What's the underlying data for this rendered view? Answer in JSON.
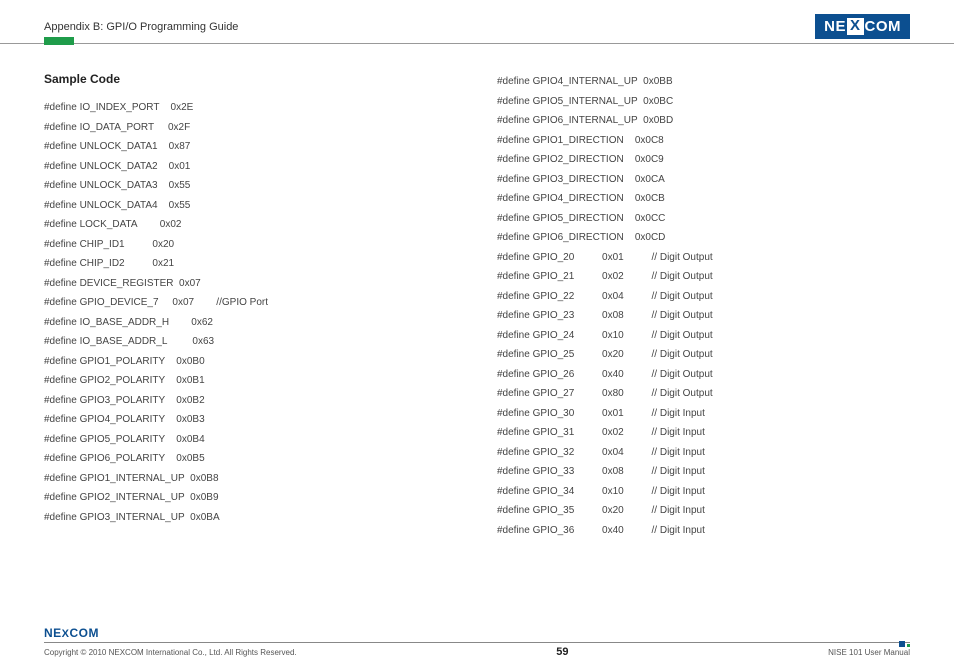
{
  "header": {
    "title": "Appendix B: GPI/O Programming Guide",
    "logo_left": "NE",
    "logo_mid": "X",
    "logo_right": "COM"
  },
  "section_heading": "Sample Code",
  "left_lines": [
    {
      "text": "#define IO_INDEX_PORT    0x2E"
    },
    {
      "text": "#define IO_DATA_PORT     0x2F"
    },
    {
      "text": "#define UNLOCK_DATA1    0x87"
    },
    {
      "text": "#define UNLOCK_DATA2    0x01"
    },
    {
      "text": "#define UNLOCK_DATA3    0x55"
    },
    {
      "text": "#define UNLOCK_DATA4    0x55"
    },
    {
      "text": "#define LOCK_DATA        0x02"
    },
    {
      "text": "#define CHIP_ID1          0x20"
    },
    {
      "text": "#define CHIP_ID2          0x21"
    },
    {
      "text": "#define DEVICE_REGISTER  0x07"
    },
    {
      "text": "#define GPIO_DEVICE_7     0x07        //GPIO Port"
    },
    {
      "text": "#define IO_BASE_ADDR_H        0x62"
    },
    {
      "text": "#define IO_BASE_ADDR_L         0x63"
    },
    {
      "text": "#define GPIO1_POLARITY    0x0B0"
    },
    {
      "text": "#define GPIO2_POLARITY    0x0B1"
    },
    {
      "text": "#define GPIO3_POLARITY    0x0B2"
    },
    {
      "text": "#define GPIO4_POLARITY    0x0B3"
    },
    {
      "text": "#define GPIO5_POLARITY    0x0B4"
    },
    {
      "text": "#define GPIO6_POLARITY    0x0B5"
    },
    {
      "text": "#define GPIO1_INTERNAL_UP  0x0B8"
    },
    {
      "text": "#define GPIO2_INTERNAL_UP  0x0B9"
    },
    {
      "text": "#define GPIO3_INTERNAL_UP  0x0BA"
    }
  ],
  "right_lines": [
    {
      "text": "#define GPIO4_INTERNAL_UP  0x0BB"
    },
    {
      "text": "#define GPIO5_INTERNAL_UP  0x0BC"
    },
    {
      "text": "#define GPIO6_INTERNAL_UP  0x0BD"
    },
    {
      "text": "#define GPIO1_DIRECTION    0x0C8"
    },
    {
      "text": "#define GPIO2_DIRECTION    0x0C9"
    },
    {
      "text": "#define GPIO3_DIRECTION    0x0CA"
    },
    {
      "text": "#define GPIO4_DIRECTION    0x0CB"
    },
    {
      "text": "#define GPIO5_DIRECTION    0x0CC"
    },
    {
      "text": "#define GPIO6_DIRECTION    0x0CD"
    },
    {
      "text": "#define GPIO_20          0x01          // Digit Output"
    },
    {
      "text": "#define GPIO_21          0x02          // Digit Output"
    },
    {
      "text": "#define GPIO_22          0x04          // Digit Output"
    },
    {
      "text": "#define GPIO_23          0x08          // Digit Output"
    },
    {
      "text": "#define GPIO_24          0x10          // Digit Output"
    },
    {
      "text": "#define GPIO_25          0x20          // Digit Output"
    },
    {
      "text": "#define GPIO_26          0x40          // Digit Output"
    },
    {
      "text": "#define GPIO_27          0x80          // Digit Output"
    },
    {
      "text": "#define GPIO_30          0x01          // Digit Input"
    },
    {
      "text": "#define GPIO_31          0x02          // Digit Input"
    },
    {
      "text": "#define GPIO_32          0x04          // Digit Input"
    },
    {
      "text": "#define GPIO_33          0x08          // Digit Input"
    },
    {
      "text": "#define GPIO_34          0x10          // Digit Input"
    },
    {
      "text": "#define GPIO_35          0x20          // Digit Input"
    },
    {
      "text": "#define GPIO_36          0x40          // Digit Input"
    }
  ],
  "footer": {
    "logo_text_a": "NE",
    "logo_text_b": "X",
    "logo_text_c": "COM",
    "copyright": "Copyright © 2010 NEXCOM International Co., Ltd. All Rights Reserved.",
    "page_number": "59",
    "doc_ref": "NISE 101 User Manual"
  }
}
